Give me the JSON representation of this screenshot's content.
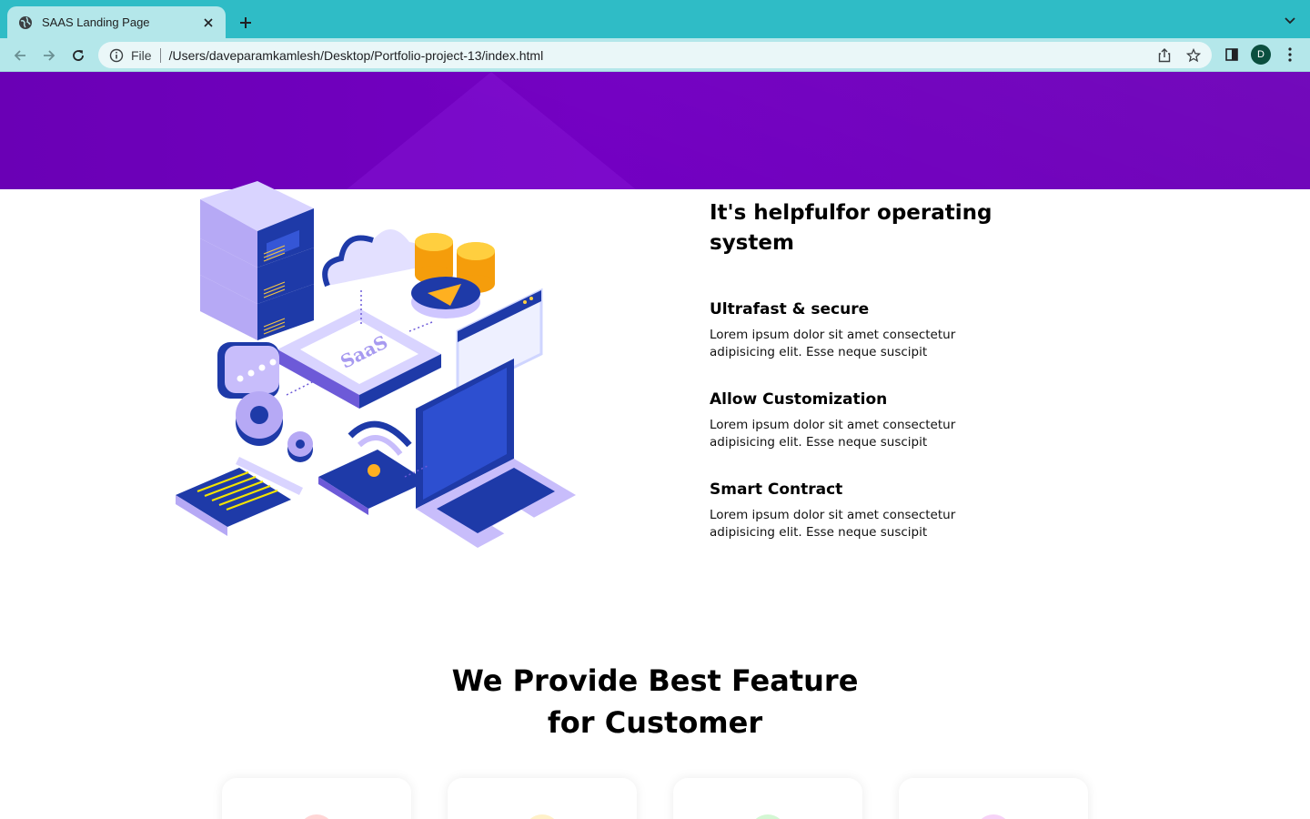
{
  "browser": {
    "tab_title": "SAAS Landing Page",
    "address_scheme": "File",
    "address_url": "/Users/daveparamkamlesh/Desktop/Portfolio-project-13/index.html",
    "profile_initial": "D",
    "icons": [
      "globe-icon",
      "close-icon",
      "plus-icon",
      "chevron-down-icon",
      "back-arrow-icon",
      "forward-arrow-icon",
      "reload-icon",
      "info-icon",
      "share-icon",
      "star-icon",
      "side-panel-icon",
      "kebab-menu-icon"
    ]
  },
  "content": {
    "illustration_label": "SaaS",
    "info_heading": "It's helpfulfor operating system",
    "features": [
      {
        "title": "Ultrafast & secure",
        "text": "Lorem ipsum dolor sit amet consectetur adipisicing elit. Esse neque suscipit"
      },
      {
        "title": "Allow Customization",
        "text": "Lorem ipsum dolor sit amet consectetur adipisicing elit. Esse neque suscipit"
      },
      {
        "title": "Smart Contract",
        "text": "Lorem ipsum dolor sit amet consectetur adipisicing elit. Esse neque suscipit"
      }
    ],
    "section_title_line1": "We Provide Best Feature",
    "section_title_line2": "for Customer",
    "card_accents": [
      "#ffd6d6",
      "#fff1c9",
      "#d4f7d4",
      "#f6d3f7"
    ]
  },
  "colors": {
    "tabbar": "#2fbcc6",
    "toolbar": "#b4e7ea",
    "hero_purple": "#7000bd"
  }
}
